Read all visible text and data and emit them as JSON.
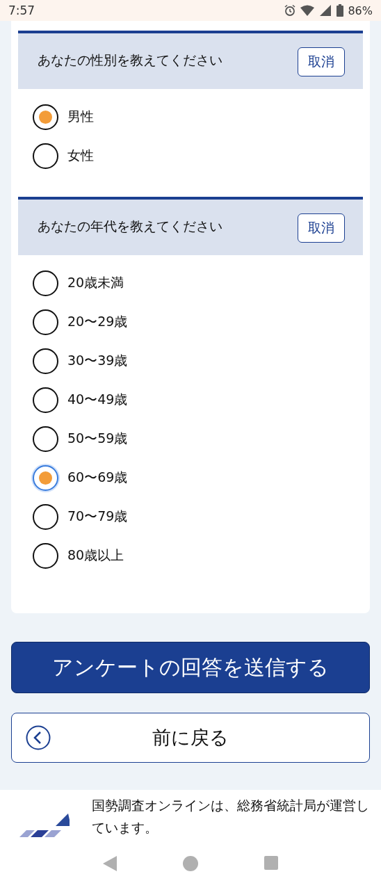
{
  "status_bar": {
    "time": "7:57",
    "battery": "86%"
  },
  "questions": [
    {
      "title": "あなたの性別を教えてください",
      "cancel": "取消",
      "options": [
        {
          "label": "男性",
          "selected": true,
          "focused": false
        },
        {
          "label": "女性",
          "selected": false,
          "focused": false
        }
      ]
    },
    {
      "title": "あなたの年代を教えてください",
      "cancel": "取消",
      "options": [
        {
          "label": "20歳未満",
          "selected": false,
          "focused": false
        },
        {
          "label": "20〜29歳",
          "selected": false,
          "focused": false
        },
        {
          "label": "30〜39歳",
          "selected": false,
          "focused": false
        },
        {
          "label": "40〜49歳",
          "selected": false,
          "focused": false
        },
        {
          "label": "50〜59歳",
          "selected": false,
          "focused": false
        },
        {
          "label": "60〜69歳",
          "selected": true,
          "focused": true
        },
        {
          "label": "70〜79歳",
          "selected": false,
          "focused": false
        },
        {
          "label": "80歳以上",
          "selected": false,
          "focused": false
        }
      ]
    }
  ],
  "submit_button": "アンケートの回答を送信する",
  "back_button": "前に戻る",
  "footer": {
    "text": "国勢調査オンラインは、総務省統計局が運営しています。"
  }
}
